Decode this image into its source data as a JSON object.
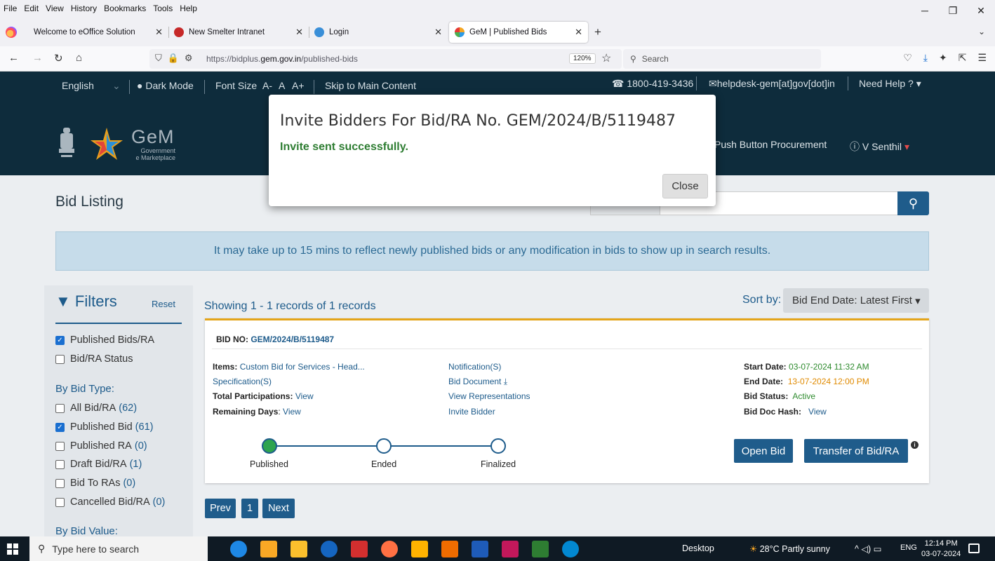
{
  "menubar": [
    "File",
    "Edit",
    "View",
    "History",
    "Bookmarks",
    "Tools",
    "Help"
  ],
  "tabs": [
    {
      "label": "Welcome to eOffice Solution",
      "icon": "eoffice-icon"
    },
    {
      "label": "New Smelter Intranet",
      "icon": "smelter-icon"
    },
    {
      "label": "Login",
      "icon": "login-icon"
    },
    {
      "label": "GeM | Published Bids",
      "icon": "gem-icon",
      "active": true
    }
  ],
  "address": {
    "prefix": "https://bidplus.",
    "domain": "gem.gov.in",
    "path": "/published-bids",
    "zoom": "120%"
  },
  "browser_search": {
    "placeholder": "Search"
  },
  "gem_header": {
    "language": "English",
    "dark_mode": "Dark Mode",
    "font_size": "Font Size",
    "font_small": "A-",
    "font_normal": "A",
    "font_large": "A+",
    "skip": "Skip to Main Content",
    "phone": "1800-419-3436",
    "email": "helpdesk-gem[at]gov[dot]in",
    "need_help": "Need Help ?",
    "logo_text": "GeM",
    "logo_sub1": "Government",
    "logo_sub2": "e Marketplace",
    "push_button": "Push Button Procurement",
    "user": "V Senthil"
  },
  "page": {
    "title": "Bid Listing",
    "notice": "It may take up to 15 mins to reflect newly published bids or any modification in bids to show up in search results.",
    "showing": "Showing 1 - 1 records of 1 records",
    "sort_label": "Sort by:",
    "sort_value": "Bid End Date: Latest First"
  },
  "filters": {
    "title": "Filters",
    "reset": "Reset",
    "top": [
      {
        "label": "Published Bids/RA",
        "checked": true
      },
      {
        "label": "Bid/RA Status",
        "checked": false
      }
    ],
    "by_type_heading": "By Bid Type:",
    "by_type": [
      {
        "label": "All Bid/RA",
        "count": "(62)",
        "checked": false
      },
      {
        "label": "Published Bid",
        "count": "(61)",
        "checked": true
      },
      {
        "label": "Published RA",
        "count": "(0)",
        "checked": false
      },
      {
        "label": "Draft Bid/RA",
        "count": "(1)",
        "checked": false
      },
      {
        "label": "Bid To RAs",
        "count": "(0)",
        "checked": false
      },
      {
        "label": "Cancelled Bid/RA",
        "count": "(0)",
        "checked": false
      }
    ],
    "by_value_heading": "By Bid Value:"
  },
  "bid": {
    "bid_no_label": "BID NO:",
    "bid_no": "GEM/2024/B/5119487",
    "items_label": "Items:",
    "items": "Custom Bid for Services - Head...",
    "specification": "Specification(S)",
    "participations_label": "Total Participations:",
    "participations": "View",
    "remaining_label": "Remaining Days",
    "remaining": "View",
    "notification": "Notification(S)",
    "bid_document": "Bid Document",
    "view_representations": "View Representations",
    "invite_bidder": "Invite Bidder",
    "start_label": "Start Date:",
    "start": "03-07-2024 11:32 AM",
    "end_label": "End Date:",
    "end": "13-07-2024 12:00 PM",
    "status_label": "Bid Status:",
    "status": "Active",
    "hash_label": "Bid Doc Hash:",
    "hash": "View",
    "stages": [
      "Published",
      "Ended",
      "Finalized"
    ],
    "open_bid": "Open Bid",
    "transfer": "Transfer of Bid/RA"
  },
  "pagination": {
    "prev": "Prev",
    "page": "1",
    "next": "Next"
  },
  "modal": {
    "title": "Invite Bidders For Bid/RA No. GEM/2024/B/5119487",
    "message": "Invite sent successfully.",
    "close": "Close"
  },
  "taskbar": {
    "search_placeholder": "Type here to search",
    "desktop": "Desktop",
    "weather": "28°C  Partly sunny",
    "lang": "ENG",
    "time": "12:14 PM",
    "date": "03-07-2024"
  },
  "colors": {
    "header_bg": "#0e2c3c",
    "accent": "#1f5c8b",
    "success": "#2e7d32"
  }
}
